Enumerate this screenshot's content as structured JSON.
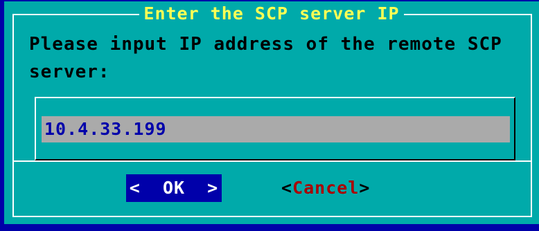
{
  "dialog": {
    "title": "Enter the SCP server IP",
    "prompt": "Please input IP address of the remote SCP server:",
    "input": {
      "value": "10.4.33.199"
    },
    "buttons": {
      "ok": {
        "left_bracket": "<",
        "label": "OK",
        "right_bracket": ">"
      },
      "cancel": {
        "left_bracket": "<",
        "hotkey": "C",
        "rest": "ancel",
        "right_bracket": ">"
      }
    }
  },
  "colors": {
    "screen_background": "#0000a8",
    "dialog_background": "#00aaaa",
    "title_text": "#ffff55",
    "input_background": "#aaaaaa",
    "input_text": "#0000aa",
    "selected_button_background": "#0000aa",
    "hotkey_text": "#aa0000"
  }
}
